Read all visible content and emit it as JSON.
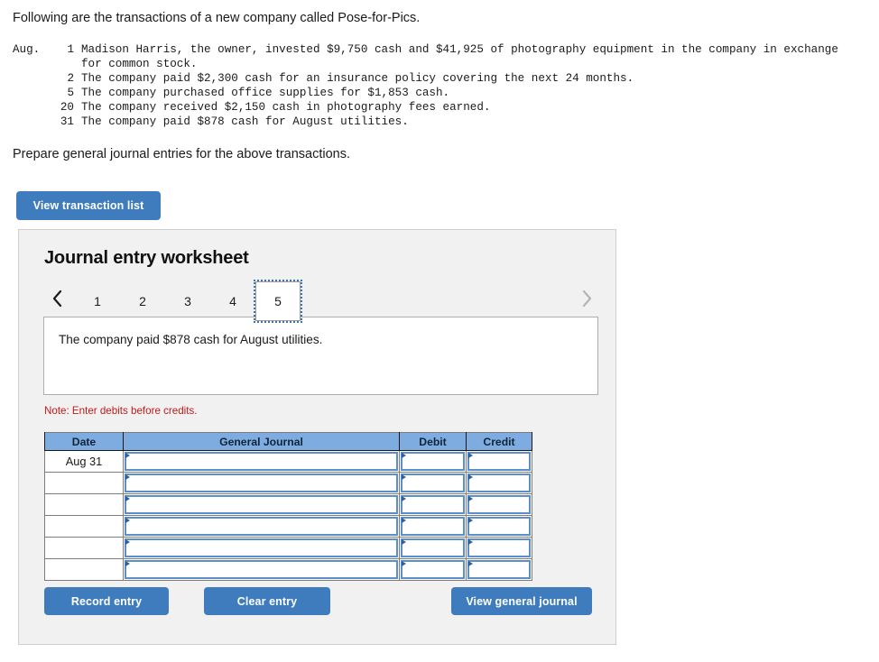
{
  "intro": {
    "text": "Following are the transactions of a new company called Pose-for-Pics."
  },
  "transactions": {
    "month_label": "Aug.",
    "rows": [
      {
        "day": "1",
        "text": "Madison Harris, the owner, invested $9,750 cash and $41,925 of photography equipment in the company in exchange",
        "cont": "for common stock."
      },
      {
        "day": "2",
        "text": "The company paid $2,300 cash for an insurance policy covering the next 24 months.",
        "cont": ""
      },
      {
        "day": "5",
        "text": "The company purchased office supplies for $1,853 cash.",
        "cont": ""
      },
      {
        "day": "20",
        "text": "The company received $2,150 cash in photography fees earned.",
        "cont": ""
      },
      {
        "day": "31",
        "text": "The company paid $878 cash for August utilities.",
        "cont": ""
      }
    ]
  },
  "prompt": {
    "text": "Prepare general journal entries for the above transactions."
  },
  "buttons": {
    "view_transaction_list": "View transaction list",
    "record_entry": "Record entry",
    "clear_entry": "Clear entry",
    "view_general_journal": "View general journal"
  },
  "worksheet": {
    "title": "Journal entry worksheet",
    "tabs": [
      {
        "label": "1",
        "active": false
      },
      {
        "label": "2",
        "active": false
      },
      {
        "label": "3",
        "active": false
      },
      {
        "label": "4",
        "active": false
      },
      {
        "label": "5",
        "active": true
      }
    ],
    "nav": {
      "prev_icon": "chevron-left-icon",
      "next_icon": "chevron-right-icon",
      "prev_enabled": true,
      "next_enabled": false
    },
    "description": "The company paid $878 cash for August utilities.",
    "note": "Note: Enter debits before credits.",
    "table": {
      "headers": [
        "Date",
        "General Journal",
        "Debit",
        "Credit"
      ],
      "rows": [
        {
          "date": "Aug 31",
          "general_journal": "",
          "debit": "",
          "credit": ""
        },
        {
          "date": "",
          "general_journal": "",
          "debit": "",
          "credit": ""
        },
        {
          "date": "",
          "general_journal": "",
          "debit": "",
          "credit": ""
        },
        {
          "date": "",
          "general_journal": "",
          "debit": "",
          "credit": ""
        },
        {
          "date": "",
          "general_journal": "",
          "debit": "",
          "credit": ""
        },
        {
          "date": "",
          "general_journal": "",
          "debit": "",
          "credit": ""
        }
      ]
    }
  },
  "colors": {
    "button_blue": "#3f7cbe",
    "table_header_blue": "#7eace0",
    "input_border_blue": "#5c8fc9",
    "note_red": "#c01919",
    "panel_gray": "#f1f1f1"
  }
}
